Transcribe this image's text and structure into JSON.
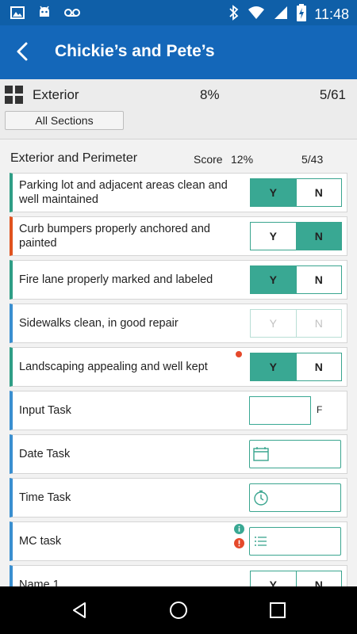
{
  "statusbar": {
    "time": "11:48",
    "icons": [
      "image-icon",
      "android-icon",
      "voicemail-icon",
      "bluetooth-icon",
      "wifi-icon",
      "signal-icon",
      "battery-charging-icon"
    ]
  },
  "appbar": {
    "title": "Chickie’s and Pete’s",
    "back_icon": "arrow-back-icon"
  },
  "summary": {
    "icon": "grid-icon",
    "name": "Exterior",
    "percent": "8%",
    "count": "5/61",
    "all_sections_label": "All Sections"
  },
  "section": {
    "name": "Exterior and Perimeter",
    "score_label": "Score",
    "score_percent": "12%",
    "count": "5/43"
  },
  "items": [
    {
      "label": "Parking lot and adjacent areas clean and well maintained",
      "type": "yn",
      "yes": "Y",
      "no": "N",
      "selected": "Y",
      "bar_color": "#2f9e86"
    },
    {
      "label": "Curb bumpers properly anchored and painted",
      "type": "yn",
      "yes": "Y",
      "no": "N",
      "selected": "N",
      "bar_color": "#e0531f"
    },
    {
      "label": "Fire lane properly marked and labeled",
      "type": "yn",
      "yes": "Y",
      "no": "N",
      "selected": "Y",
      "bar_color": "#2f9e86"
    },
    {
      "label": "Sidewalks clean, in good repair",
      "type": "yn",
      "yes": "Y",
      "no": "N",
      "selected": "",
      "disabled": true,
      "bar_color": "#3a8fd0"
    },
    {
      "label": "Landscaping appealing and well kept",
      "type": "yn",
      "yes": "Y",
      "no": "N",
      "selected": "Y",
      "flagged": true,
      "bar_color": "#2f9e86"
    },
    {
      "label": "Input Task",
      "type": "input",
      "value": "",
      "unit": "F",
      "bar_color": "#3a8fd0"
    },
    {
      "label": "Date Task",
      "type": "date",
      "icon": "calendar-icon",
      "bar_color": "#3a8fd0"
    },
    {
      "label": "Time Task",
      "type": "time",
      "icon": "stopwatch-icon",
      "bar_color": "#3a8fd0"
    },
    {
      "label": "MC task",
      "type": "mc",
      "icon": "list-icon",
      "bar_color": "#3a8fd0"
    },
    {
      "label": "Name 1",
      "type": "yn",
      "yes": "Y",
      "no": "N",
      "selected": "",
      "bar_color": "#3a8fd0"
    }
  ],
  "navbar": {
    "icons": [
      "back-triangle-icon",
      "home-circle-icon",
      "recents-square-icon"
    ]
  },
  "colors": {
    "primary": "#1467b9",
    "statusbar": "#0f5fa8",
    "accent": "#39a893",
    "alert": "#e5492b"
  }
}
